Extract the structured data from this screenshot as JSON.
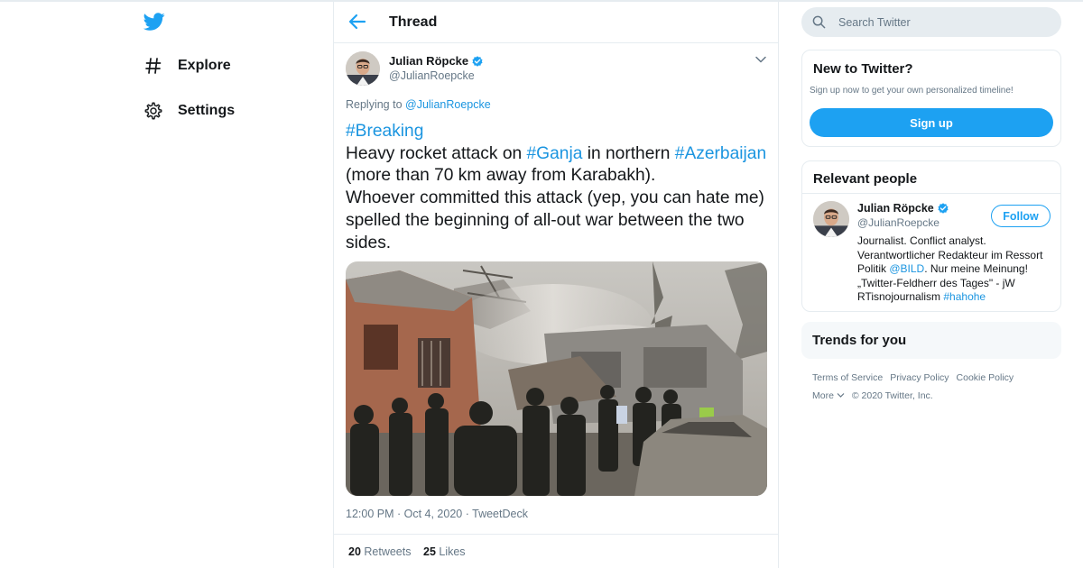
{
  "nav": {
    "items": [
      {
        "label": "Explore"
      },
      {
        "label": "Settings"
      }
    ]
  },
  "header": {
    "title": "Thread"
  },
  "tweet": {
    "author_name": "Julian Röpcke",
    "author_handle": "@JulianRoepcke",
    "replying_prefix": "Replying to ",
    "replying_to": "@JulianRoepcke",
    "lines": [
      [
        {
          "t": "#Breaking",
          "tag": true
        }
      ],
      [
        {
          "t": "Heavy rocket attack on "
        },
        {
          "t": "#Ganja",
          "tag": true
        },
        {
          "t": " in northern "
        },
        {
          "t": "#Azerbaijan",
          "tag": true
        }
      ],
      [
        {
          "t": "(more than 70 km away from Karabakh)."
        }
      ],
      [
        {
          "t": "Whoever committed this attack (yep, you can hate me)"
        }
      ],
      [
        {
          "t": "spelled the beginning of all-out war between the two"
        }
      ],
      [
        {
          "t": "sides."
        }
      ]
    ],
    "timestamp": "12:00 PM · Oct 4, 2020 · TweetDeck",
    "retweets_count": "20",
    "retweets_label": " Retweets",
    "likes_count": "25",
    "likes_label": " Likes"
  },
  "search": {
    "placeholder": "Search Twitter"
  },
  "new_to_twitter": {
    "title": "New to Twitter?",
    "subtitle": "Sign up now to get your own personalized timeline!",
    "button": "Sign up"
  },
  "relevant_people": {
    "title": "Relevant people",
    "name": "Julian Röpcke",
    "handle": "@JulianRoepcke",
    "follow": "Follow",
    "bio_lines": [
      [
        {
          "t": "Journalist. Conflict analyst."
        }
      ],
      [
        {
          "t": "Verantwortlicher Redakteur im Ressort"
        }
      ],
      [
        {
          "t": "Politik "
        },
        {
          "t": "@BILD",
          "link": true
        },
        {
          "t": ". Nur meine Meinung!"
        }
      ],
      [
        {
          "t": "„Twitter-Feldherr des Tages\" - jW"
        }
      ],
      [
        {
          "t": "RTisnojournalism "
        },
        {
          "t": "#hahohe",
          "link": true
        }
      ]
    ]
  },
  "trends": {
    "title": "Trends for you"
  },
  "footer": {
    "links": [
      "Terms of Service",
      "Privacy Policy",
      "Cookie Policy"
    ],
    "more": "More",
    "copyright": "© 2020 Twitter, Inc."
  },
  "colors": {
    "accent": "#1da1f2",
    "link": "#1b95e0",
    "muted": "#657786",
    "verified": "#1da1f2"
  },
  "icons": [
    "twitter-logo-icon",
    "hashtag-icon",
    "gear-icon",
    "back-arrow-icon",
    "verified-badge-icon",
    "chevron-down-icon",
    "search-icon"
  ]
}
